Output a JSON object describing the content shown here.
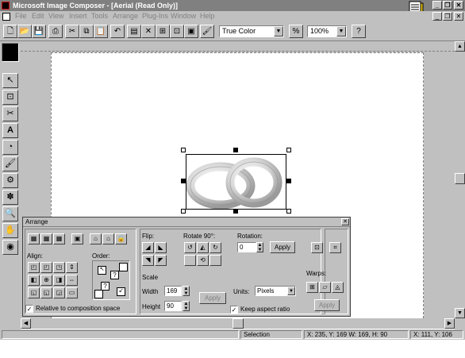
{
  "window": {
    "title": "Microsoft Image Composer - [Aerial (Read Only)]",
    "caption_min": "_",
    "caption_restore": "❐",
    "caption_close": "✕"
  },
  "menu": {
    "items": [
      "File",
      "Edit",
      "View",
      "Insert",
      "Tools",
      "Arrange",
      "Plug-Ins",
      "Window",
      "Help"
    ]
  },
  "toolbar": {
    "color_mode": "True Color",
    "zoom_pct_icon": "%",
    "zoom": "100%"
  },
  "arrange": {
    "title": "Arrange",
    "close_label": "✕",
    "align_label": "Align:",
    "order_label": "Order:",
    "relative_label": "Relative to composition space",
    "flip_label": "Flip:",
    "rotate_label": "Rotate 90°:",
    "rotation_label": "Rotation:",
    "rotation_value": "0",
    "rotation_apply": "Apply",
    "scale_label": "Scale",
    "width_label": "Width",
    "width_value": "169",
    "height_label": "Height",
    "height_value": "90",
    "scale_apply": "Apply",
    "units_label": "Units:",
    "units_value": "Pixels",
    "keep_aspect_label": "Keep aspect ratio",
    "warps_label": "Warps:",
    "warps_apply": "Apply",
    "order_marks": [
      "?",
      "?"
    ]
  },
  "status": {
    "mode": "Selection",
    "object_info": "X: 235, Y: 169  W: 169, H: 90",
    "cursor": "X: 111, Y: 106"
  },
  "colors": {
    "face": "#c0c0c0",
    "title_inactive": "#808080",
    "canvas": "#ffffff",
    "current_color": "#000000"
  }
}
